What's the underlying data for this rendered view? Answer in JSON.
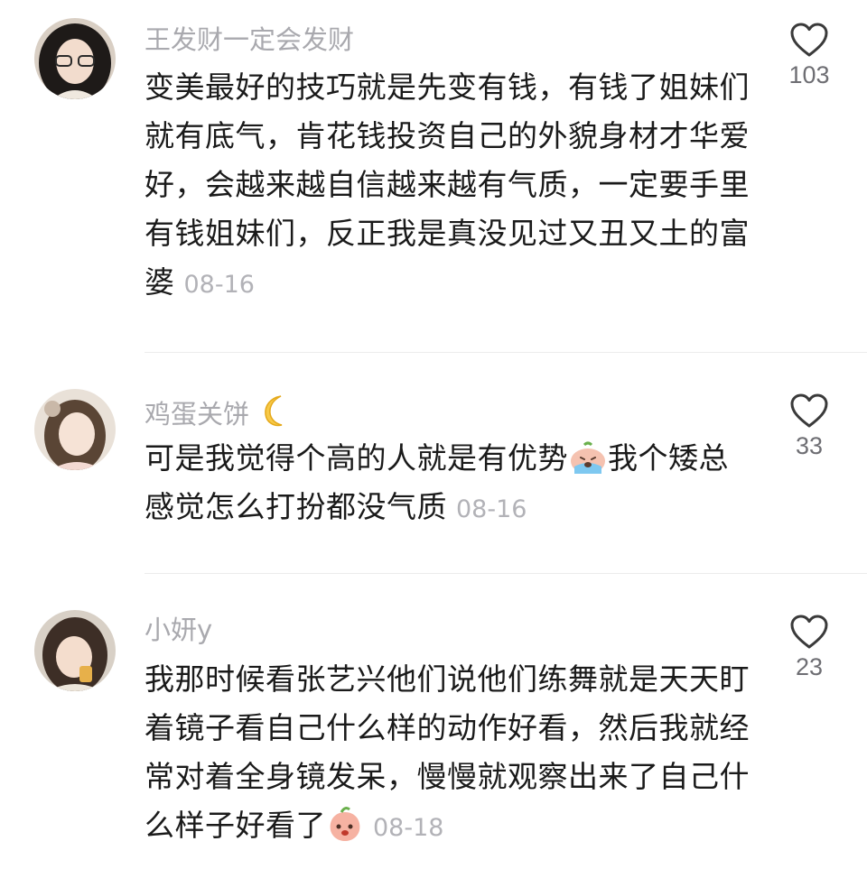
{
  "comments": [
    {
      "username": "王发财一定会发财",
      "text": "变美最好的技巧就是先变有钱，有钱了姐妹们就有底气，肯花钱投资自己的外貌身材才华爱好，会越来越自信越来越有气质，一定要手里有钱姐妹们，反正我是真没见过又丑又土的富婆",
      "date": "08-16",
      "likes": "103"
    },
    {
      "username": "鸡蛋关饼",
      "username_emoji": "crescent-moon-emoji",
      "text_before": "可是我觉得个高的人就是有优势",
      "inline_emoji": "crying-emoji",
      "text_after": "我个矮总感觉怎么打扮都没气质",
      "date": "08-16",
      "likes": "33"
    },
    {
      "username": "小妍y",
      "text": "我那时候看张艺兴他们说他们练舞就是天天盯着镜子看自己什么样的动作好看，然后我就经常对着全身镜发呆，慢慢就观察出来了自己什么样子好看了",
      "inline_emoji": "peach-shy-emoji",
      "date": "08-18",
      "likes": "23"
    }
  ],
  "colors": {
    "username": "#a9a9ae",
    "text": "#1a1a1a",
    "date": "#b2b2b7",
    "heart": "#3a3a3a"
  }
}
